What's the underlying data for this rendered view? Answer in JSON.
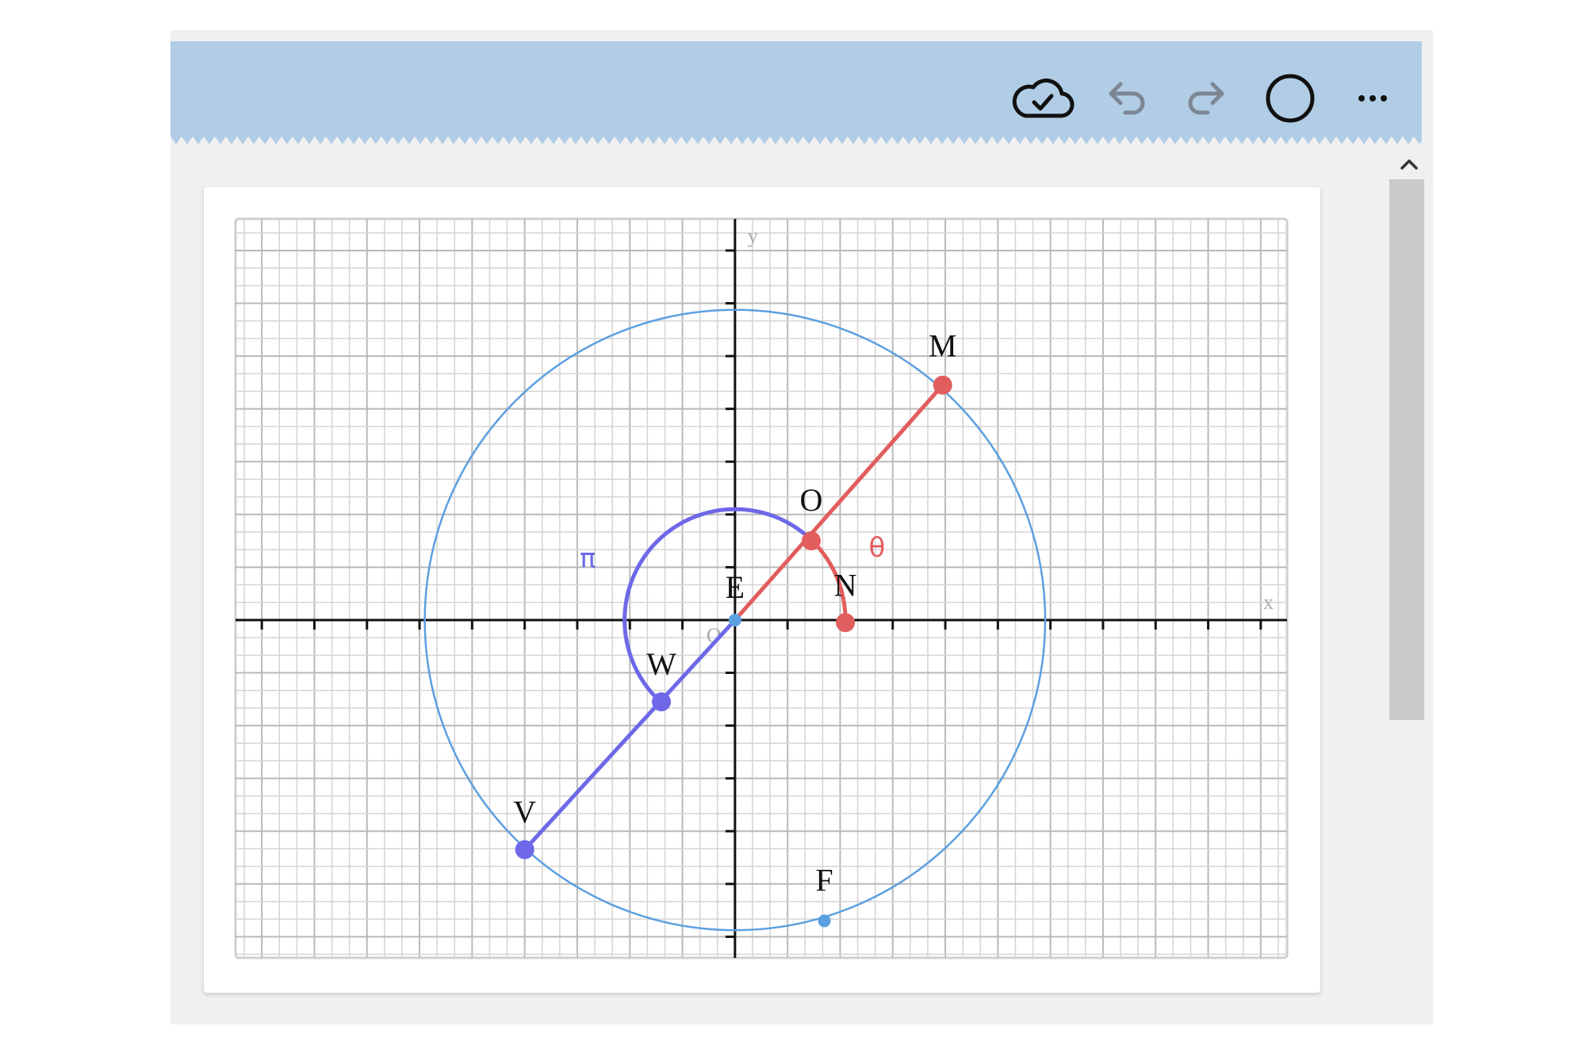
{
  "toolbar": {
    "save_status_icon": "cloud-check-icon",
    "undo_icon": "undo-icon",
    "redo_icon": "redo-icon",
    "shape_icon": "circle-icon",
    "more_icon": "more-horizontal-icon"
  },
  "colors": {
    "header": "#b1cde6",
    "circle": "#5b9fe0",
    "red_construction": "#e25d5d",
    "purple_construction": "#6e68e8",
    "grid_line": "#c4c4c4",
    "axis": "#111111"
  },
  "graph": {
    "x_range": [
      -9.5,
      10.5
    ],
    "y_range": [
      -6.4,
      7.6
    ],
    "x_axis_label": "x",
    "y_axis_label": "y",
    "origin_label": "O",
    "circle": {
      "center": [
        0,
        0
      ],
      "radius": 5.9
    },
    "points": [
      {
        "id": "M",
        "label": "M",
        "x": 3.95,
        "y": 4.45,
        "kind": "red"
      },
      {
        "id": "O",
        "label": "O",
        "x": 1.45,
        "y": 1.5,
        "kind": "red"
      },
      {
        "id": "N",
        "label": "N",
        "x": 2.1,
        "y": -0.05,
        "kind": "red"
      },
      {
        "id": "E",
        "label": "E",
        "x": 0.0,
        "y": 0.0,
        "kind": "blue-small"
      },
      {
        "id": "W",
        "label": "W",
        "x": -1.4,
        "y": -1.55,
        "kind": "purple"
      },
      {
        "id": "V",
        "label": "V",
        "x": -4.0,
        "y": -4.35,
        "kind": "purple"
      },
      {
        "id": "F",
        "label": "F",
        "x": 1.7,
        "y": -5.7,
        "kind": "blue-small"
      }
    ],
    "angle_labels": [
      {
        "id": "theta",
        "text": "θ",
        "x": 2.7,
        "y": 1.2,
        "kind": "red"
      },
      {
        "id": "pi",
        "text": "π",
        "x": -2.8,
        "y": 1.0,
        "kind": "purple"
      }
    ],
    "arc_radius": 2.1
  }
}
